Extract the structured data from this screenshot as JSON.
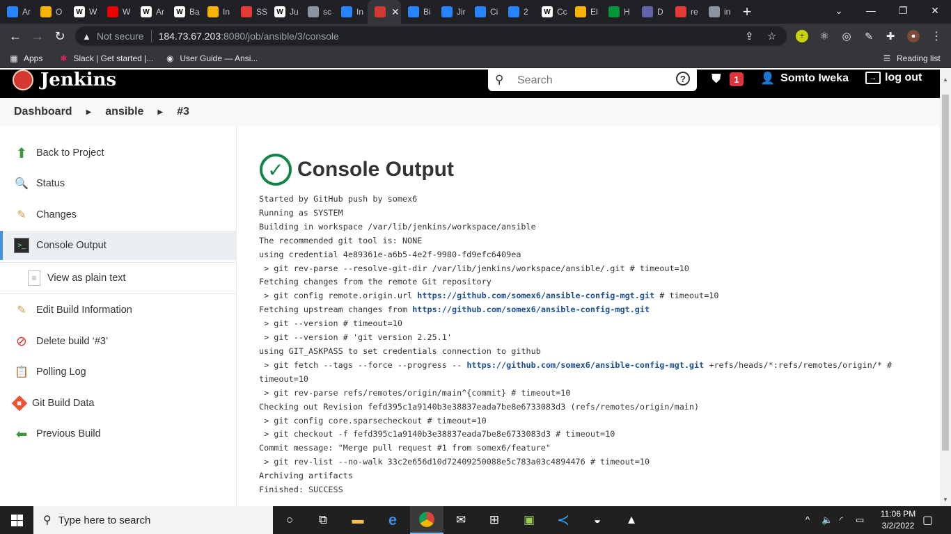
{
  "browser": {
    "tabs": [
      {
        "label": "Ar",
        "icon": "jira-icon",
        "color": "#2684ff"
      },
      {
        "label": "O",
        "icon": "box-icon",
        "color": "#f4b400"
      },
      {
        "label": "W",
        "icon": "wikipedia-icon",
        "color": "#ffffff"
      },
      {
        "label": "W",
        "icon": "redhat-icon",
        "color": "#ee0000"
      },
      {
        "label": "Ar",
        "icon": "wikipedia-icon",
        "color": "#ffffff"
      },
      {
        "label": "Ba",
        "icon": "wikipedia-icon",
        "color": "#ffffff"
      },
      {
        "label": "In",
        "icon": "box-icon",
        "color": "#f4b400"
      },
      {
        "label": "SS",
        "icon": "ssl-icon",
        "color": "#e53935"
      },
      {
        "label": "Ju",
        "icon": "wikipedia-icon",
        "color": "#ffffff"
      },
      {
        "label": "sc",
        "icon": "github-icon",
        "color": "#8b949e"
      },
      {
        "label": "In",
        "icon": "jira-icon",
        "color": "#2684ff"
      },
      {
        "label": "",
        "icon": "jenkins-icon",
        "color": "#d33833",
        "active": true
      },
      {
        "label": "Bi",
        "icon": "jira-icon",
        "color": "#2684ff"
      },
      {
        "label": "Jir",
        "icon": "atlassian-icon",
        "color": "#2684ff"
      },
      {
        "label": "Ci",
        "icon": "jira-icon",
        "color": "#2684ff"
      },
      {
        "label": "2",
        "icon": "jira-icon",
        "color": "#2684ff"
      },
      {
        "label": "Cc",
        "icon": "medium-icon",
        "color": "#ffffff"
      },
      {
        "label": "El",
        "icon": "box-icon",
        "color": "#f4b400"
      },
      {
        "label": "H",
        "icon": "nginx-icon",
        "color": "#009639"
      },
      {
        "label": "D",
        "icon": "teams-icon",
        "color": "#6264a7"
      },
      {
        "label": "re",
        "icon": "grid-icon",
        "color": "#e53935"
      },
      {
        "label": "in",
        "icon": "github-icon",
        "color": "#8b949e"
      }
    ],
    "address": {
      "security": "Not secure",
      "host": "184.73.67.203",
      "path": ":8080/job/ansible/3/console"
    },
    "bookmarks": [
      {
        "label": "Apps",
        "icon": "apps-grid-icon"
      },
      {
        "label": "Slack | Get started |...",
        "icon": "slack-icon"
      },
      {
        "label": "User Guide — Ansi...",
        "icon": "globe-icon"
      }
    ],
    "reading_list": "Reading list"
  },
  "jenkins": {
    "brand": "Jenkins",
    "search_placeholder": "Search",
    "notification_count": "1",
    "user_name": "Somto Iweka",
    "logout_label": "log out",
    "breadcrumb": [
      "Dashboard",
      "ansible",
      "#3"
    ],
    "sidebar": [
      {
        "label": "Back to Project",
        "icon": "up-arrow-icon"
      },
      {
        "label": "Status",
        "icon": "magnifier-icon"
      },
      {
        "label": "Changes",
        "icon": "notepad-icon"
      },
      {
        "label": "Console Output",
        "icon": "terminal-icon",
        "active": true
      },
      {
        "label": "View as plain text",
        "icon": "document-icon",
        "sub": true
      },
      {
        "label": "Edit Build Information",
        "icon": "notepad-icon"
      },
      {
        "label": "Delete build ‘#3’",
        "icon": "no-entry-icon"
      },
      {
        "label": "Polling Log",
        "icon": "clipboard-icon"
      },
      {
        "label": "Git Build Data",
        "icon": "git-icon"
      },
      {
        "label": "Previous Build",
        "icon": "left-arrow-icon"
      }
    ],
    "page_title": "Console Output",
    "console_lines": [
      [
        {
          "t": "Started by GitHub push by somex6"
        }
      ],
      [
        {
          "t": "Running as SYSTEM"
        }
      ],
      [
        {
          "t": "Building in workspace /var/lib/jenkins/workspace/ansible"
        }
      ],
      [
        {
          "t": "The recommended git tool is: NONE"
        }
      ],
      [
        {
          "t": "using credential 4e89361e-a6b5-4e2f-9980-fd9efc6409ea"
        }
      ],
      [
        {
          "t": " > git rev-parse --resolve-git-dir /var/lib/jenkins/workspace/ansible/.git # timeout=10"
        }
      ],
      [
        {
          "t": "Fetching changes from the remote Git repository"
        }
      ],
      [
        {
          "t": " > git config remote.origin.url "
        },
        {
          "t": "https://github.com/somex6/ansible-config-mgt.git",
          "link": true
        },
        {
          "t": " # timeout=10"
        }
      ],
      [
        {
          "t": "Fetching upstream changes from "
        },
        {
          "t": "https://github.com/somex6/ansible-config-mgt.git",
          "link": true
        }
      ],
      [
        {
          "t": " > git --version # timeout=10"
        }
      ],
      [
        {
          "t": " > git --version # 'git version 2.25.1'"
        }
      ],
      [
        {
          "t": "using GIT_ASKPASS to set credentials connection to github"
        }
      ],
      [
        {
          "t": " > git fetch --tags --force --progress -- "
        },
        {
          "t": "https://github.com/somex6/ansible-config-mgt.git",
          "link": true
        },
        {
          "t": " +refs/heads/*:refs/remotes/origin/* #"
        }
      ],
      [
        {
          "t": "timeout=10"
        }
      ],
      [
        {
          "t": " > git rev-parse refs/remotes/origin/main^{commit} # timeout=10"
        }
      ],
      [
        {
          "t": "Checking out Revision fefd395c1a9140b3e38837eada7be8e6733083d3 (refs/remotes/origin/main)"
        }
      ],
      [
        {
          "t": " > git config core.sparsecheckout # timeout=10"
        }
      ],
      [
        {
          "t": " > git checkout -f fefd395c1a9140b3e38837eada7be8e6733083d3 # timeout=10"
        }
      ],
      [
        {
          "t": "Commit message: \"Merge pull request #1 from somex6/feature\""
        }
      ],
      [
        {
          "t": " > git rev-list --no-walk 33c2e656d10d72409250088e5c783a03c4894476 # timeout=10"
        }
      ],
      [
        {
          "t": "Archiving artifacts"
        }
      ],
      [
        {
          "t": "Finished: SUCCESS"
        }
      ]
    ]
  },
  "taskbar": {
    "search_placeholder": "Type here to search",
    "time": "11:06 PM",
    "date": "3/2/2022"
  }
}
